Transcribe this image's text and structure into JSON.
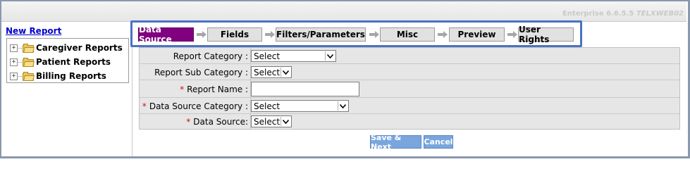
{
  "header": {
    "version_text": "Enterprise 6.6.5.5",
    "brand_text": "TELXWEB02"
  },
  "sidebar": {
    "new_report_link": "New Report",
    "tree": [
      {
        "label": "Caregiver Reports",
        "expander": "+",
        "icon": "folder-icon"
      },
      {
        "label": "Patient Reports",
        "expander": "+",
        "icon": "folder-icon"
      },
      {
        "label": "Billing Reports",
        "expander": "+",
        "icon": "folder-icon"
      }
    ]
  },
  "wizard": {
    "active_step": "Data Source",
    "active_color": "#800080",
    "highlight_color": "#4a72c4",
    "steps": [
      {
        "label": "Data Source"
      },
      {
        "label": "Fields"
      },
      {
        "label": "Filters/Parameters"
      },
      {
        "label": "Misc"
      },
      {
        "label": "Preview"
      },
      {
        "label": "User Rights"
      }
    ]
  },
  "form": {
    "required_marker": "*",
    "fields": [
      {
        "label": "Report Category :",
        "required": false,
        "type": "select",
        "value": "Select"
      },
      {
        "label": "Report Sub Category :",
        "required": false,
        "type": "select",
        "value": "Select"
      },
      {
        "label": "Report Name :",
        "required": true,
        "type": "text",
        "value": ""
      },
      {
        "label": "Data Source Category :",
        "required": true,
        "type": "select",
        "value": "Select"
      },
      {
        "label": "Data Source:",
        "required": true,
        "type": "select",
        "value": "Select"
      }
    ]
  },
  "actions": {
    "save_next": "Save & Next",
    "cancel": "Cancel",
    "button_color": "#7aa6de"
  }
}
